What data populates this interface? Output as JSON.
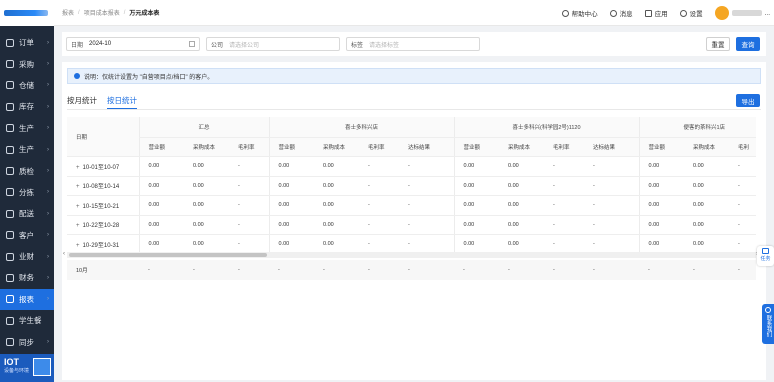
{
  "sidebar": {
    "items": [
      {
        "label": "订单",
        "arrow": "›"
      },
      {
        "label": "采购",
        "arrow": "›"
      },
      {
        "label": "仓储",
        "arrow": "›"
      },
      {
        "label": "库存",
        "arrow": "›"
      },
      {
        "label": "生产",
        "arrow": "›"
      },
      {
        "label": "生产",
        "arrow": "›"
      },
      {
        "label": "质检",
        "arrow": "›"
      },
      {
        "label": "分拣",
        "arrow": "›"
      },
      {
        "label": "配送",
        "arrow": "›"
      },
      {
        "label": "客户",
        "arrow": "›"
      },
      {
        "label": "业财",
        "arrow": "›"
      },
      {
        "label": "财务",
        "arrow": "›"
      },
      {
        "label": "报表",
        "arrow": "›"
      },
      {
        "label": "学生餐",
        "arrow": ""
      },
      {
        "label": "同步",
        "arrow": "›"
      }
    ],
    "footer": {
      "title": "IOT",
      "subtitle": "设备与环境"
    }
  },
  "header": {
    "breadcrumb": [
      "报表",
      "项目成本报表",
      "万元成本表"
    ],
    "help": "帮助中心",
    "messages": "消息",
    "apps": "应用",
    "settings": "设置",
    "more": "..."
  },
  "filter": {
    "date_label": "日期",
    "date_value": "2024-10",
    "company_label": "公司",
    "company_placeholder": "请选择公司",
    "tag_label": "标签",
    "tag_placeholder": "请选择标签",
    "reset": "重置",
    "query": "查询"
  },
  "notice": "说明：仅统计设置为 \"自营项目点/档口\" 的客户。",
  "tabs": [
    "按月统计",
    "按日统计"
  ],
  "export": "导出",
  "table": {
    "date_header": "日期",
    "groups": [
      {
        "name": "汇总",
        "cols": [
          "营业额",
          "采购成本",
          "毛利率"
        ]
      },
      {
        "name": "喜士多科兴店",
        "cols": [
          "营业额",
          "采购成本",
          "毛利率",
          "达标结果"
        ]
      },
      {
        "name": "喜士多科兴(科学园2号)1120",
        "cols": [
          "营业额",
          "采购成本",
          "毛利率",
          "达标结果"
        ]
      },
      {
        "name": "便客的茶科兴1店",
        "cols": [
          "营业额",
          "采购成本",
          "毛利"
        ]
      }
    ],
    "rows": [
      {
        "date": "10-01至10-07",
        "cells": [
          "0.00",
          "0.00",
          "-",
          "0.00",
          "0.00",
          "-",
          "-",
          "0.00",
          "0.00",
          "-",
          "-",
          "0.00",
          "0.00",
          "-"
        ]
      },
      {
        "date": "10-08至10-14",
        "cells": [
          "0.00",
          "0.00",
          "-",
          "0.00",
          "0.00",
          "-",
          "-",
          "0.00",
          "0.00",
          "-",
          "-",
          "0.00",
          "0.00",
          "-"
        ]
      },
      {
        "date": "10-15至10-21",
        "cells": [
          "0.00",
          "0.00",
          "-",
          "0.00",
          "0.00",
          "-",
          "-",
          "0.00",
          "0.00",
          "-",
          "-",
          "0.00",
          "0.00",
          "-"
        ]
      },
      {
        "date": "10-22至10-28",
        "cells": [
          "0.00",
          "0.00",
          "-",
          "0.00",
          "0.00",
          "-",
          "-",
          "0.00",
          "0.00",
          "-",
          "-",
          "0.00",
          "0.00",
          "-"
        ]
      },
      {
        "date": "10-29至10-31",
        "cells": [
          "0.00",
          "0.00",
          "-",
          "0.00",
          "0.00",
          "-",
          "-",
          "0.00",
          "0.00",
          "-",
          "-",
          "0.00",
          "0.00",
          "-"
        ]
      }
    ],
    "summary": {
      "label": "10月",
      "cells": [
        "-",
        "-",
        "-",
        "-",
        "-",
        "-",
        "-",
        "-",
        "-",
        "-",
        "-",
        "-",
        "-",
        "-"
      ]
    }
  },
  "float": {
    "task": "任务",
    "contact": "联系我们"
  },
  "colors": {
    "primary": "#1e6fe0",
    "sidebar": "#1f2a3a"
  }
}
